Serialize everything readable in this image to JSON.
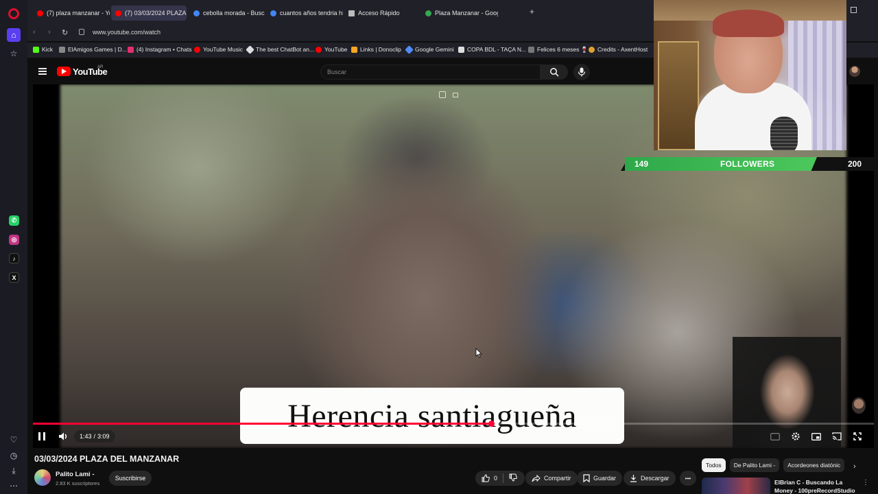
{
  "browser": {
    "tabs": [
      {
        "label": "(7) plaza manzanar - YouT",
        "favicon_color": "#ff0000"
      },
      {
        "label": "(7) 03/03/2024 PLAZA",
        "favicon_color": "#ff0000"
      },
      {
        "label": "cebolla morada - Buscar c",
        "favicon_color": "#4285f4"
      },
      {
        "label": "cuantos años tendria hitle",
        "favicon_color": "#4285f4"
      },
      {
        "label": "Acceso Rápido",
        "favicon_color": "#bbbbbb"
      },
      {
        "label": "Plaza Manzanar - Google",
        "favicon_color": "#34a853"
      }
    ],
    "url": "www.youtube.com/watch",
    "bookmarks": [
      {
        "label": "Kick",
        "color": "#53fc18"
      },
      {
        "label": "ElAmigos Games | D...",
        "color": "#888888"
      },
      {
        "label": "(4) Instagram • Chats",
        "color": "#e1306c"
      },
      {
        "label": "YouTube Music",
        "color": "#ff0000"
      },
      {
        "label": "The best ChatBot an...",
        "color": "#dddddd"
      },
      {
        "label": "YouTube",
        "color": "#ff0000"
      },
      {
        "label": "Links | Donoclip",
        "color": "#f5a623"
      },
      {
        "label": "Google Gemini",
        "color": "#4f8df5"
      },
      {
        "label": "COPA BDL - TAÇA N...",
        "color": "#dddddd"
      },
      {
        "label": "Felices 6 meses 🍷",
        "color": "#cc3355"
      },
      {
        "label": "Credits - AxentHost",
        "color": "#e0a030"
      }
    ]
  },
  "youtube": {
    "logo_text": "YouTube",
    "country_code": "AR",
    "search_placeholder": "Buscar"
  },
  "player": {
    "caption": "Herencia santiagueña",
    "current_time": "1:43",
    "separator": "/",
    "duration": "3:09",
    "progress_fraction": 0.545
  },
  "stream_overlay": {
    "followers_current": "149",
    "followers_label": "FOLLOWERS",
    "followers_goal": "200"
  },
  "video_info": {
    "title": "03/03/2024 PLAZA DEL MANZANAR",
    "channel_name": "Palito Lami -",
    "subscribers": "2.83 K suscriptores",
    "subscribe_label": "Suscribirse",
    "likes": "0",
    "share_label": "Compartir",
    "save_label": "Guardar",
    "download_label": "Descargar",
    "more_label": "•••"
  },
  "recommendations": {
    "chips": [
      "Todos",
      "De Palito Lami -",
      "Acordeones diatónic"
    ],
    "first_item_title": "ElBrian C - Buscando La Money - 100preRecordStudio ..."
  }
}
